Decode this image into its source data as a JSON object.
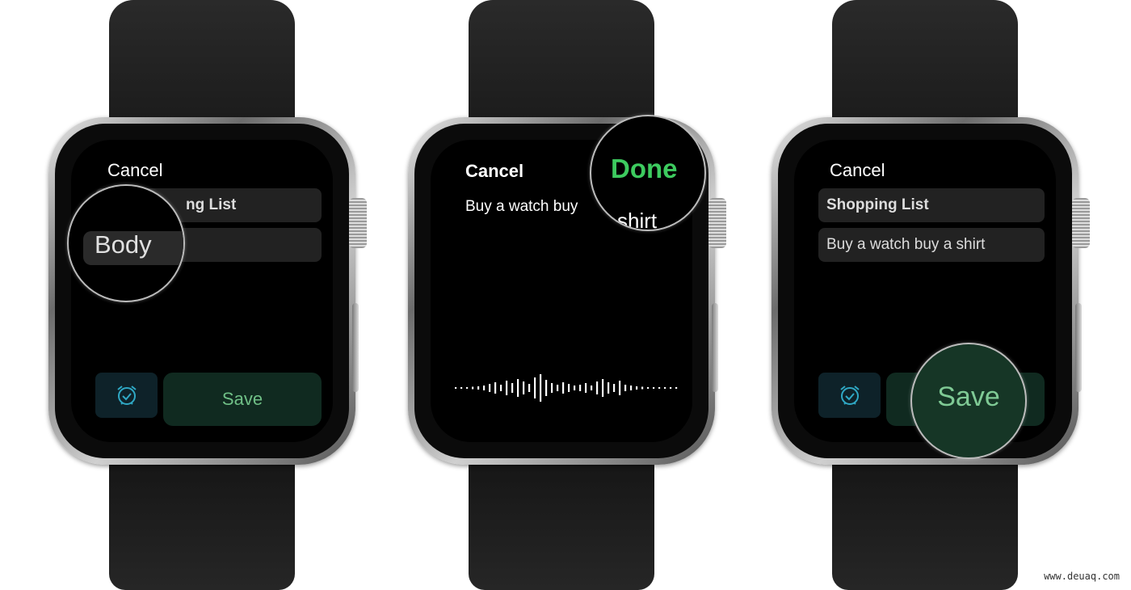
{
  "screens": [
    {
      "cancel": "Cancel",
      "title_field": "Shopping List",
      "title_visible": "ng List",
      "body_field": "Body",
      "save": "Save"
    },
    {
      "cancel": "Cancel",
      "done": "Done",
      "dictation": "Buy a watch buy",
      "dictation_mag": "shirt"
    },
    {
      "cancel": "Cancel",
      "title_field": "Shopping List",
      "body_field": "Buy a watch buy a shirt",
      "save": "Save"
    }
  ],
  "colors": {
    "done": "#3dcb5f",
    "save_text": "#6fbf86",
    "alarm_icon": "#2fa8c4"
  },
  "icons": {
    "alarm": "alarm-clock-check-icon"
  },
  "watermark": "www.deuaq.com"
}
